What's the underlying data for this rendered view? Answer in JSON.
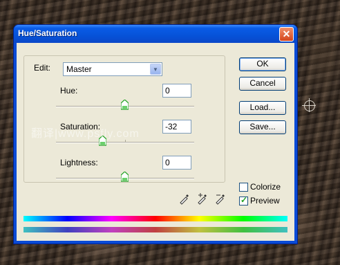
{
  "window": {
    "title": "Hue/Saturation"
  },
  "edit": {
    "label": "Edit:",
    "value": "Master"
  },
  "hue": {
    "label": "Hue:",
    "value": "0"
  },
  "saturation": {
    "label": "Saturation:",
    "value": "-32"
  },
  "lightness": {
    "label": "Lightness:",
    "value": "0"
  },
  "watermark": "翻译|www.psfly.com",
  "buttons": {
    "ok": "OK",
    "cancel": "Cancel",
    "load": "Load...",
    "save": "Save..."
  },
  "colorize": {
    "label": "Colorize",
    "checked": false
  },
  "preview": {
    "label": "Preview",
    "checked": true
  }
}
